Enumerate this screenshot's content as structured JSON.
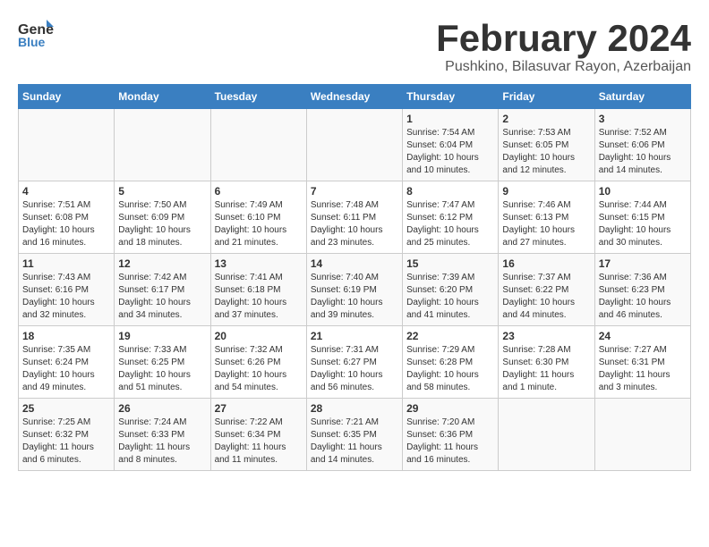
{
  "header": {
    "logo_general": "General",
    "logo_blue": "Blue",
    "title": "February 2024",
    "subtitle": "Pushkino, Bilasuvar Rayon, Azerbaijan"
  },
  "days_of_week": [
    "Sunday",
    "Monday",
    "Tuesday",
    "Wednesday",
    "Thursday",
    "Friday",
    "Saturday"
  ],
  "weeks": [
    [
      {
        "day": "",
        "info": ""
      },
      {
        "day": "",
        "info": ""
      },
      {
        "day": "",
        "info": ""
      },
      {
        "day": "",
        "info": ""
      },
      {
        "day": "1",
        "info": "Sunrise: 7:54 AM\nSunset: 6:04 PM\nDaylight: 10 hours\nand 10 minutes."
      },
      {
        "day": "2",
        "info": "Sunrise: 7:53 AM\nSunset: 6:05 PM\nDaylight: 10 hours\nand 12 minutes."
      },
      {
        "day": "3",
        "info": "Sunrise: 7:52 AM\nSunset: 6:06 PM\nDaylight: 10 hours\nand 14 minutes."
      }
    ],
    [
      {
        "day": "4",
        "info": "Sunrise: 7:51 AM\nSunset: 6:08 PM\nDaylight: 10 hours\nand 16 minutes."
      },
      {
        "day": "5",
        "info": "Sunrise: 7:50 AM\nSunset: 6:09 PM\nDaylight: 10 hours\nand 18 minutes."
      },
      {
        "day": "6",
        "info": "Sunrise: 7:49 AM\nSunset: 6:10 PM\nDaylight: 10 hours\nand 21 minutes."
      },
      {
        "day": "7",
        "info": "Sunrise: 7:48 AM\nSunset: 6:11 PM\nDaylight: 10 hours\nand 23 minutes."
      },
      {
        "day": "8",
        "info": "Sunrise: 7:47 AM\nSunset: 6:12 PM\nDaylight: 10 hours\nand 25 minutes."
      },
      {
        "day": "9",
        "info": "Sunrise: 7:46 AM\nSunset: 6:13 PM\nDaylight: 10 hours\nand 27 minutes."
      },
      {
        "day": "10",
        "info": "Sunrise: 7:44 AM\nSunset: 6:15 PM\nDaylight: 10 hours\nand 30 minutes."
      }
    ],
    [
      {
        "day": "11",
        "info": "Sunrise: 7:43 AM\nSunset: 6:16 PM\nDaylight: 10 hours\nand 32 minutes."
      },
      {
        "day": "12",
        "info": "Sunrise: 7:42 AM\nSunset: 6:17 PM\nDaylight: 10 hours\nand 34 minutes."
      },
      {
        "day": "13",
        "info": "Sunrise: 7:41 AM\nSunset: 6:18 PM\nDaylight: 10 hours\nand 37 minutes."
      },
      {
        "day": "14",
        "info": "Sunrise: 7:40 AM\nSunset: 6:19 PM\nDaylight: 10 hours\nand 39 minutes."
      },
      {
        "day": "15",
        "info": "Sunrise: 7:39 AM\nSunset: 6:20 PM\nDaylight: 10 hours\nand 41 minutes."
      },
      {
        "day": "16",
        "info": "Sunrise: 7:37 AM\nSunset: 6:22 PM\nDaylight: 10 hours\nand 44 minutes."
      },
      {
        "day": "17",
        "info": "Sunrise: 7:36 AM\nSunset: 6:23 PM\nDaylight: 10 hours\nand 46 minutes."
      }
    ],
    [
      {
        "day": "18",
        "info": "Sunrise: 7:35 AM\nSunset: 6:24 PM\nDaylight: 10 hours\nand 49 minutes."
      },
      {
        "day": "19",
        "info": "Sunrise: 7:33 AM\nSunset: 6:25 PM\nDaylight: 10 hours\nand 51 minutes."
      },
      {
        "day": "20",
        "info": "Sunrise: 7:32 AM\nSunset: 6:26 PM\nDaylight: 10 hours\nand 54 minutes."
      },
      {
        "day": "21",
        "info": "Sunrise: 7:31 AM\nSunset: 6:27 PM\nDaylight: 10 hours\nand 56 minutes."
      },
      {
        "day": "22",
        "info": "Sunrise: 7:29 AM\nSunset: 6:28 PM\nDaylight: 10 hours\nand 58 minutes."
      },
      {
        "day": "23",
        "info": "Sunrise: 7:28 AM\nSunset: 6:30 PM\nDaylight: 11 hours\nand 1 minute."
      },
      {
        "day": "24",
        "info": "Sunrise: 7:27 AM\nSunset: 6:31 PM\nDaylight: 11 hours\nand 3 minutes."
      }
    ],
    [
      {
        "day": "25",
        "info": "Sunrise: 7:25 AM\nSunset: 6:32 PM\nDaylight: 11 hours\nand 6 minutes."
      },
      {
        "day": "26",
        "info": "Sunrise: 7:24 AM\nSunset: 6:33 PM\nDaylight: 11 hours\nand 8 minutes."
      },
      {
        "day": "27",
        "info": "Sunrise: 7:22 AM\nSunset: 6:34 PM\nDaylight: 11 hours\nand 11 minutes."
      },
      {
        "day": "28",
        "info": "Sunrise: 7:21 AM\nSunset: 6:35 PM\nDaylight: 11 hours\nand 14 minutes."
      },
      {
        "day": "29",
        "info": "Sunrise: 7:20 AM\nSunset: 6:36 PM\nDaylight: 11 hours\nand 16 minutes."
      },
      {
        "day": "",
        "info": ""
      },
      {
        "day": "",
        "info": ""
      }
    ]
  ]
}
